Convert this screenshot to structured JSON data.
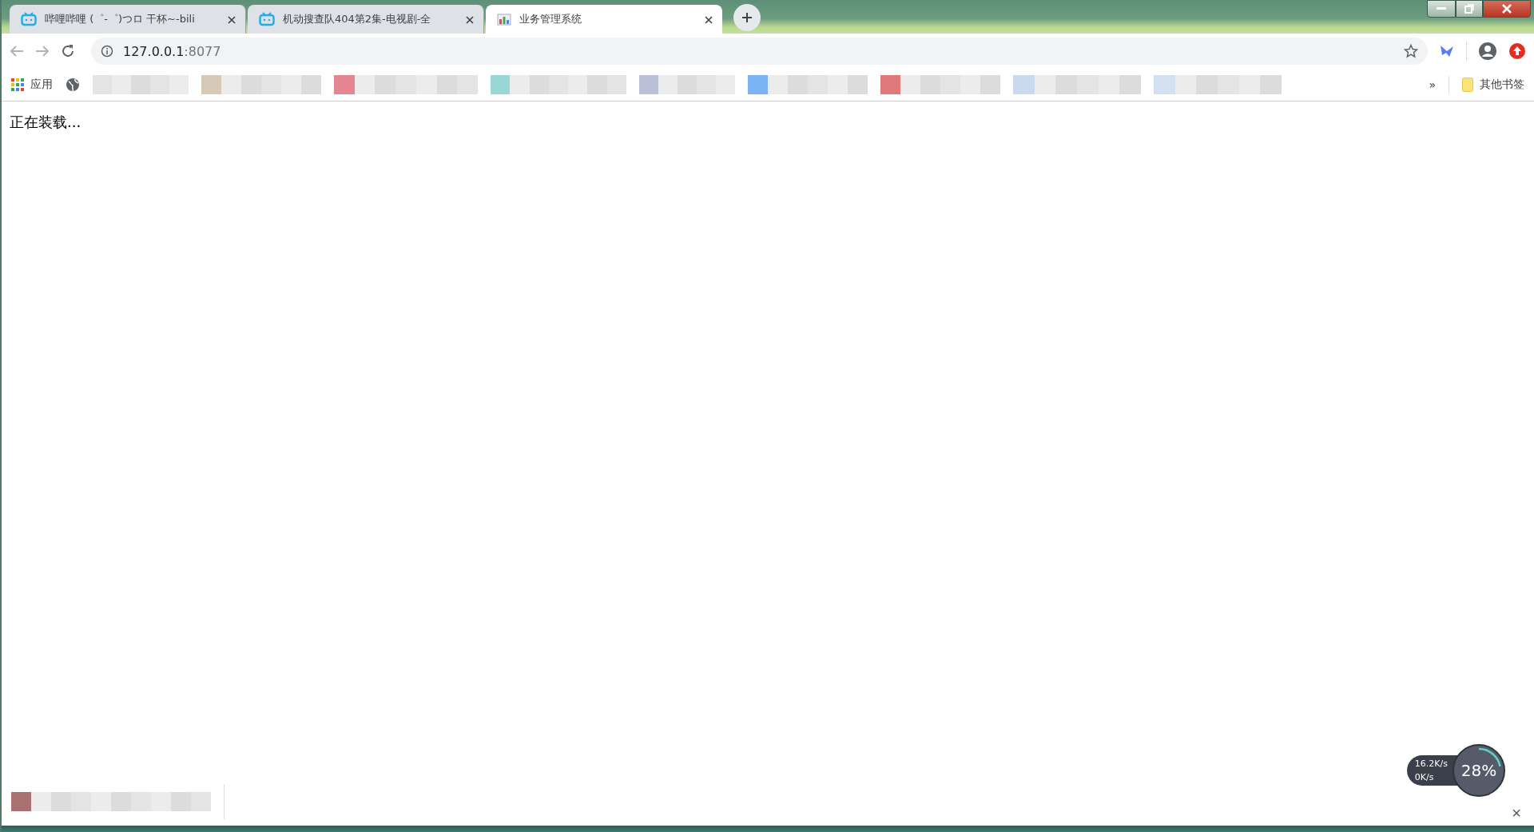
{
  "tabs": [
    {
      "title": "哔哩哔哩 (゜-゜)つロ 干杯~-bili",
      "selected": false
    },
    {
      "title": "机动搜查队404第2集-电视剧-全",
      "selected": false
    },
    {
      "title": "业务管理系统",
      "selected": true
    }
  ],
  "address_bar": {
    "host": "127.0.0.1",
    "rest": ":8077"
  },
  "bookmarks": {
    "apps_label": "应用",
    "overflow": "»",
    "other_label": "其他书签"
  },
  "page": {
    "text": "正在装载..."
  },
  "download_bar": {
    "close": "×"
  },
  "net_monitor": {
    "upload": "16.2K/s",
    "download": "0K/s",
    "cpu": "28%"
  }
}
